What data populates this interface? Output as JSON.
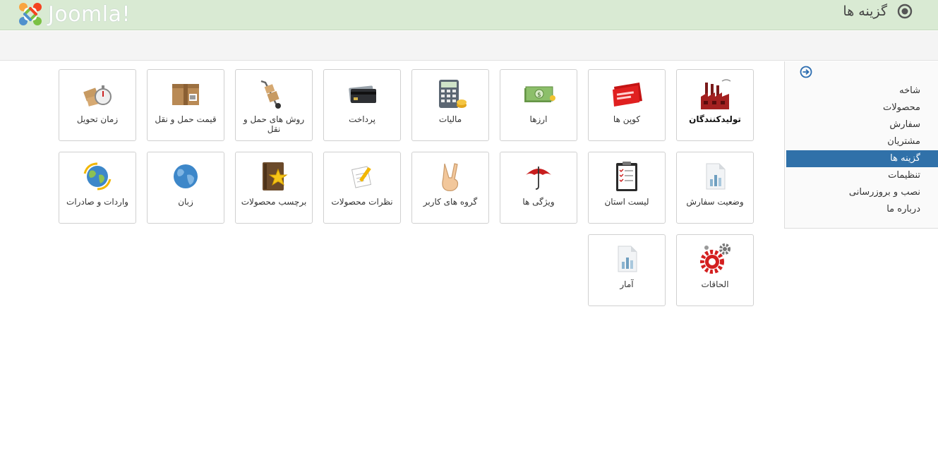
{
  "header": {
    "logo_text": "Joomla!",
    "page_title": "گزینه ها",
    "title_icon": "options-icon"
  },
  "sidebar": {
    "collapse_icon": "arrow-right-circle-icon",
    "items": [
      {
        "label": "شاخه",
        "active": false
      },
      {
        "label": "محصولات",
        "active": false
      },
      {
        "label": "سفارش",
        "active": false
      },
      {
        "label": "مشتریان",
        "active": false
      },
      {
        "label": "گزینه ها",
        "active": true
      },
      {
        "label": "تنظیمات",
        "active": false
      },
      {
        "label": "نصب و بروزرسانی",
        "active": false
      },
      {
        "label": "درباره ما",
        "active": false
      }
    ]
  },
  "tiles": [
    {
      "label": "تولیدکنندگان",
      "icon": "factory-icon"
    },
    {
      "label": "کوپن ها",
      "icon": "coupon-icon"
    },
    {
      "label": "ارزها",
      "icon": "money-icon"
    },
    {
      "label": "مالیات",
      "icon": "calculator-icon"
    },
    {
      "label": "پرداخت",
      "icon": "credit-card-icon"
    },
    {
      "label": "روش های حمل و نقل",
      "icon": "hand-truck-icon"
    },
    {
      "label": "قیمت حمل و نقل",
      "icon": "package-icon"
    },
    {
      "label": "زمان تحویل",
      "icon": "stopwatch-box-icon"
    },
    {
      "label": "وضعیت سفارش",
      "icon": "document-chart-icon"
    },
    {
      "label": "لیست استان",
      "icon": "clipboard-icon"
    },
    {
      "label": "ویژگی ها",
      "icon": "umbrella-icon"
    },
    {
      "label": "گروه های کاربر",
      "icon": "victory-hand-icon"
    },
    {
      "label": "نظرات محصولات",
      "icon": "note-pencil-icon"
    },
    {
      "label": "برچسب محصولات",
      "icon": "star-book-icon"
    },
    {
      "label": "زبان",
      "icon": "globe-icon"
    },
    {
      "label": "واردات و صادرات",
      "icon": "globe-arrows-icon"
    },
    {
      "label": "الحاقات",
      "icon": "gears-icon"
    },
    {
      "label": "آمار",
      "icon": "document-chart-icon"
    }
  ]
}
